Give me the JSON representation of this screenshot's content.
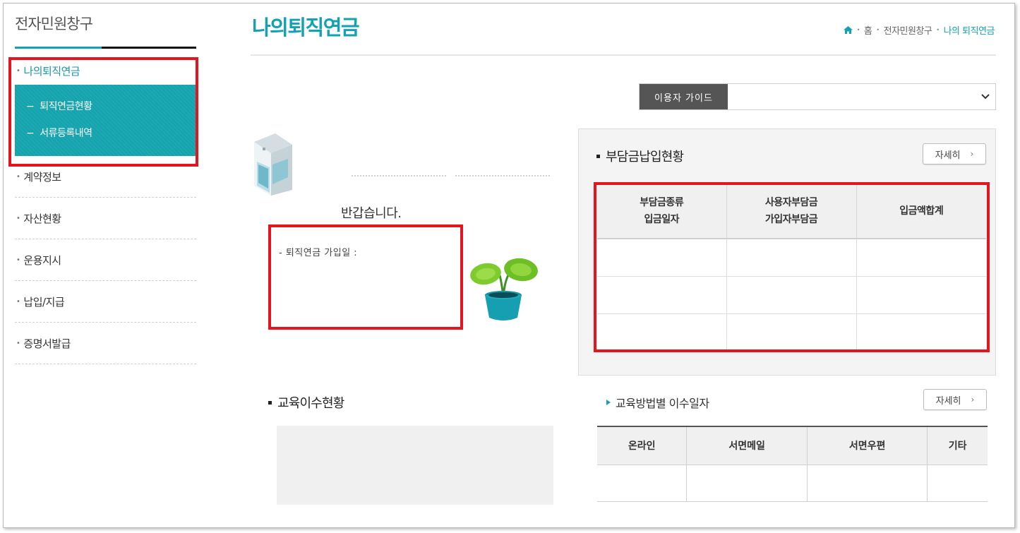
{
  "sidebar": {
    "title": "전자민원창구",
    "items": [
      {
        "label": "나의퇴직연금",
        "active": true
      },
      {
        "label": "계약정보"
      },
      {
        "label": "자산현황"
      },
      {
        "label": "운용지시"
      },
      {
        "label": "납입/지급"
      },
      {
        "label": "증명서발급"
      }
    ],
    "sub_items": [
      {
        "label": "퇴직연금현황"
      },
      {
        "label": "서류등록내역"
      }
    ]
  },
  "header": {
    "title": "나의퇴직연금",
    "breadcrumb": [
      "홈",
      "전자민원창구",
      "나의 퇴직연금"
    ]
  },
  "guide": {
    "label": "이용자 가이드",
    "selected": ""
  },
  "welcome": {
    "greeting": "반갑습니다.",
    "join_date_label": "- 퇴직연금 가입일 :"
  },
  "contribution": {
    "title": "부담금납입현황",
    "more_label": "자세히",
    "columns": [
      [
        "부담금종류",
        "입금일자"
      ],
      [
        "사용자부담금",
        "가입자부담금"
      ],
      [
        "입금액합계"
      ]
    ],
    "rows": [
      [
        "",
        "",
        ""
      ],
      [
        "",
        "",
        ""
      ],
      [
        "",
        "",
        ""
      ]
    ]
  },
  "education": {
    "title": "교육이수현황",
    "sub_title": "교육방법별 이수일자",
    "more_label": "자세히",
    "columns": [
      "온라인",
      "서면메일",
      "서면우편",
      "기타"
    ],
    "rows": [
      [
        "",
        "",
        "",
        ""
      ]
    ]
  },
  "colors": {
    "accent": "#13a3b0",
    "highlight": "#e3161f"
  }
}
